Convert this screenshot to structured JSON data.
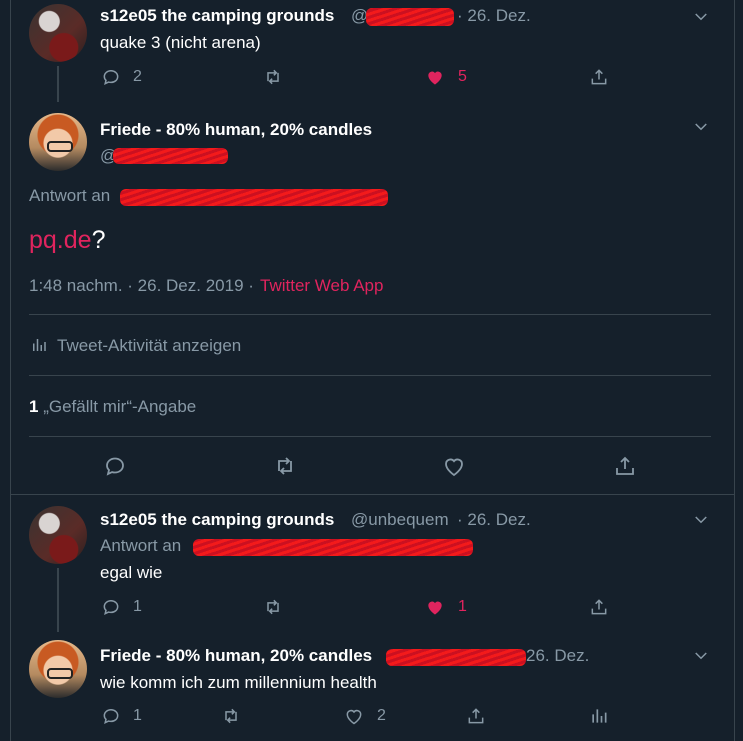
{
  "tweet1": {
    "name": "s12e05 the camping grounds",
    "date": "· 26. Dez.",
    "text": "quake 3 (nicht arena)",
    "reply_count": "2",
    "like_count": "5"
  },
  "main_tweet": {
    "name": "Friede - 80% human, 20% candles",
    "reply_label": "Antwort an",
    "link_text": "pq.de",
    "text_suffix": "?",
    "timestamp": "1:48 nachm. · 26. Dez. 2019 ·",
    "source": "Twitter Web App",
    "activity_label": "Tweet-Aktivität anzeigen",
    "likes_count": "1",
    "likes_label": "„Gefällt mir“-Angabe"
  },
  "tweet3": {
    "name": "s12e05 the camping grounds",
    "handle": "@unbequem",
    "date": "· 26. Dez.",
    "reply_label": "Antwort an",
    "text": "egal wie",
    "reply_count": "1",
    "like_count": "1"
  },
  "tweet4": {
    "name": "Friede - 80% human, 20% candles",
    "date": "26. Dez.",
    "text": "wie komm ich zum millennium health",
    "reply_count": "1",
    "like_count": "2"
  },
  "colors": {
    "background": "#15202b",
    "border": "#38444d",
    "muted": "#8899a6",
    "accent_pink": "#e0245e"
  },
  "icons": [
    "avatar",
    "chevron-down-icon",
    "reply-icon",
    "retweet-icon",
    "heart-icon",
    "share-icon",
    "analytics-icon"
  ]
}
